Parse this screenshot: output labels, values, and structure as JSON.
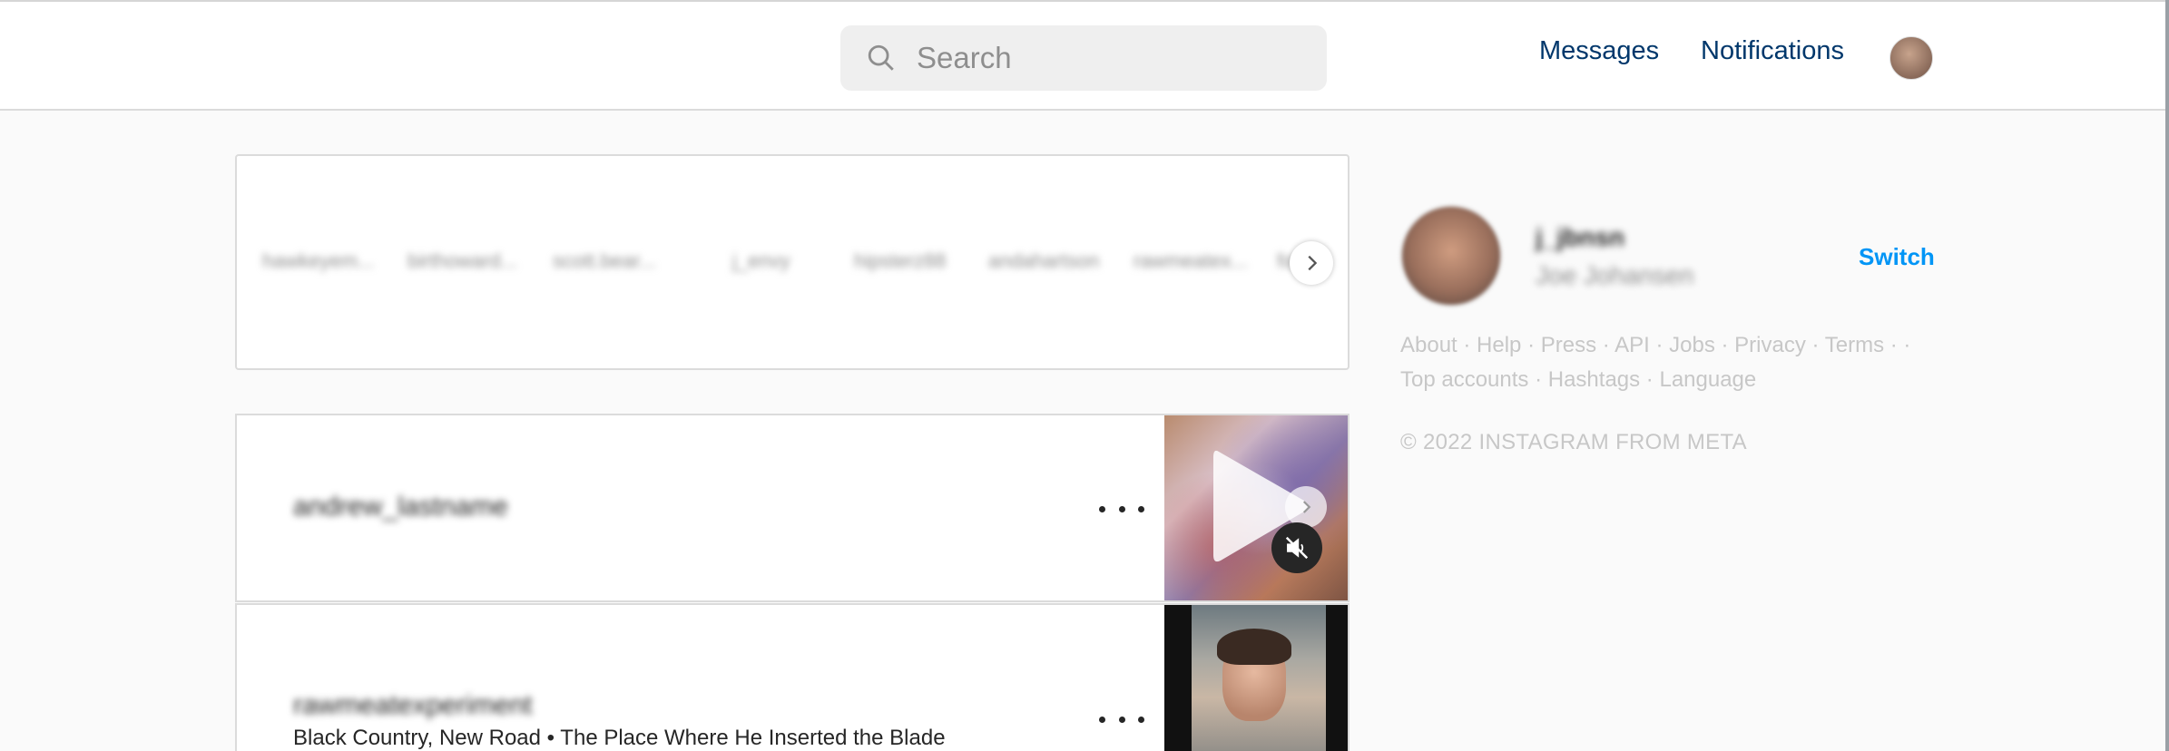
{
  "header": {
    "search_placeholder": "Search",
    "nav": {
      "messages": "Messages",
      "notifications": "Notifications"
    }
  },
  "stories": {
    "usernames": [
      "hawkeyem...",
      "birthoward...",
      "scott.bear...",
      "j_envy",
      "hipsterz88",
      "andahartson",
      "rawmeatex...",
      "fo..."
    ]
  },
  "feed": {
    "posts": [
      {
        "username": "andrew_lastname",
        "song": ""
      },
      {
        "username": "rawmeatexperiment",
        "song": "Black Country, New Road • The Place Where He Inserted the Blade"
      }
    ]
  },
  "sidebar": {
    "username": "j_jbnsn",
    "full_name": "Joe Johansen",
    "switch_label": "Switch",
    "footer_links": [
      "About",
      "Help",
      "Press",
      "API",
      "Jobs",
      "Privacy",
      "Terms",
      "Top accounts",
      "Hashtags",
      "Language"
    ],
    "copyright": "© 2022 INSTAGRAM FROM META"
  },
  "colors": {
    "link": "#00376b",
    "accent": "#0095f6",
    "muted": "#c7c7c7"
  }
}
